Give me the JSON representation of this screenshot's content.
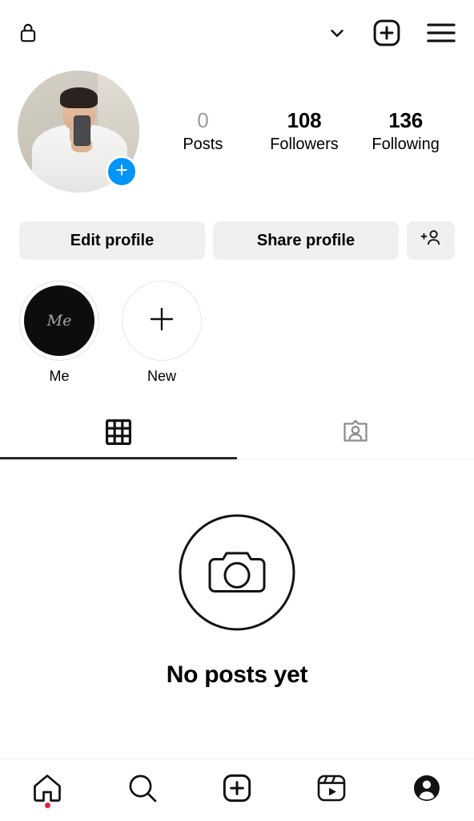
{
  "topbar": {
    "lock_icon": "lock-icon",
    "chevron_icon": "chevron-down-icon",
    "create_icon": "plus-square-icon",
    "menu_icon": "hamburger-menu-icon"
  },
  "profile": {
    "avatar_alt": "profile-photo",
    "avatar_badge_glyph": "+",
    "stats": [
      {
        "value": "0",
        "label": "Posts",
        "muted": true
      },
      {
        "value": "108",
        "label": "Followers",
        "muted": false
      },
      {
        "value": "136",
        "label": "Following",
        "muted": false
      }
    ]
  },
  "actions": {
    "edit_label": "Edit profile",
    "share_label": "Share profile",
    "add_person_icon": "add-person-icon"
  },
  "highlights": [
    {
      "label": "Me",
      "thumb_text": "Me",
      "type": "story"
    },
    {
      "label": "New",
      "thumb_text": "+",
      "type": "new"
    }
  ],
  "tabs": [
    {
      "name": "grid",
      "icon": "grid-icon",
      "active": true
    },
    {
      "name": "tagged",
      "icon": "tagged-person-icon",
      "active": false
    }
  ],
  "empty_state": {
    "icon": "camera-circle-icon",
    "title": "No posts yet"
  },
  "bottom_nav": [
    {
      "name": "home",
      "icon": "home-icon",
      "active": false,
      "badge": true
    },
    {
      "name": "search",
      "icon": "search-icon",
      "active": false,
      "badge": false
    },
    {
      "name": "create",
      "icon": "plus-square-icon",
      "active": false,
      "badge": false
    },
    {
      "name": "reels",
      "icon": "reels-icon",
      "active": false,
      "badge": false
    },
    {
      "name": "profile",
      "icon": "profile-avatar-icon",
      "active": true,
      "badge": false
    }
  ],
  "colors": {
    "accent_blue": "#0095F6",
    "button_gray": "#efefef",
    "muted_text": "#9a9a9a",
    "notification_red": "#e8213c",
    "tab_inactive": "#8e8e8e",
    "text": "#000000"
  }
}
